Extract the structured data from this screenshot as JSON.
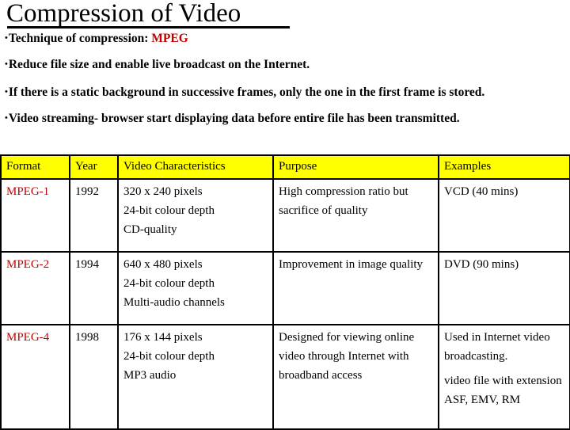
{
  "slide": {
    "title": "Compression of Video",
    "bullets": [
      {
        "marker": "•",
        "text_before": "Technique of compression: ",
        "highlight": "MPEG",
        "text_after": ""
      },
      {
        "marker": "•",
        "text_before": "Reduce file size  and enable live broadcast on the Internet.",
        "highlight": "",
        "text_after": ""
      },
      {
        "marker": "•",
        "text_before": "If there is a static background in successive frames, only the one in the first frame is stored.",
        "highlight": "",
        "text_after": ""
      },
      {
        "marker": "•",
        "text_before": "Video streaming- browser start displaying data before entire file has been transmitted.",
        "highlight": "",
        "text_after": ""
      }
    ]
  },
  "table": {
    "header_bg": "#FFFF00",
    "format_color": "#C00000",
    "columns": [
      "Format",
      "Year",
      "Video Characteristics",
      "Purpose",
      "Examples"
    ],
    "rows": [
      {
        "format": "MPEG-1",
        "year": "1992",
        "characteristics": [
          "320 x 240 pixels",
          "24-bit colour depth",
          "CD-quality"
        ],
        "purpose": [
          "High compression ratio but sacrifice of quality"
        ],
        "examples": [
          "VCD (40 mins)"
        ]
      },
      {
        "format": "MPEG-2",
        "year": "1994",
        "characteristics": [
          "640 x 480 pixels",
          "24-bit colour depth",
          "Multi-audio channels"
        ],
        "purpose": [
          "Improvement in image quality"
        ],
        "examples": [
          "DVD (90 mins)"
        ]
      },
      {
        "format": "MPEG-4",
        "year": "1998",
        "characteristics": [
          "176 x 144 pixels",
          "24-bit colour depth",
          "MP3 audio"
        ],
        "purpose": [
          "Designed for viewing online video through Internet with broadband access"
        ],
        "examples": [
          "Used in Internet video broadcasting.",
          "video file with extension ASF, EMV, RM"
        ]
      }
    ]
  }
}
